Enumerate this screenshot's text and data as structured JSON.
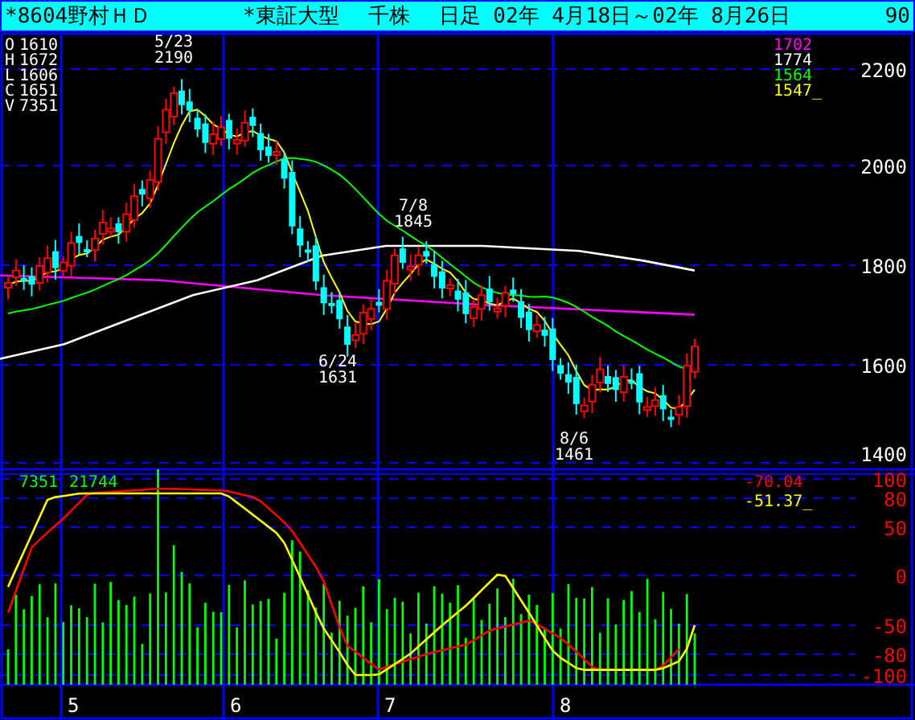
{
  "header": {
    "symbol": "*8604野村ＨＤ",
    "market": "*東証大型",
    "unit": "千株",
    "period": "日足 02年 4月18日～02年 8月26日",
    "count": "90"
  },
  "price_panel": {
    "ohlcv": [
      {
        "label": "O",
        "value": "1610"
      },
      {
        "label": "H",
        "value": "1672"
      },
      {
        "label": "L",
        "value": "1606"
      },
      {
        "label": "C",
        "value": "1651"
      },
      {
        "label": "V",
        "value": "7351"
      }
    ],
    "ma_readouts": [
      {
        "value": "1702",
        "color": "#ff00ff"
      },
      {
        "value": "1774",
        "color": "#ffffff"
      },
      {
        "value": "1564",
        "color": "#00ff00"
      },
      {
        "value": "1547_",
        "color": "#ffff00"
      }
    ],
    "y_axis": [
      "2200",
      "2000",
      "1800",
      "1600",
      "1400"
    ],
    "annotations": [
      {
        "date": "5/23",
        "price": "2190"
      },
      {
        "date": "6/24",
        "price": "1631"
      },
      {
        "date": "7/8",
        "price": "1845"
      },
      {
        "date": "8/6",
        "price": "1461"
      }
    ]
  },
  "oscillator_panel": {
    "readout": [
      "7351",
      "21744"
    ],
    "values": [
      {
        "value": "-70.04",
        "color": "#ff0000"
      },
      {
        "value": "-51.37_",
        "color": "#ffff00"
      }
    ],
    "y_axis": [
      "100",
      "80",
      "50",
      "0",
      "-50",
      "-80",
      "-100"
    ]
  },
  "x_axis": [
    "5",
    "6",
    "7",
    "8"
  ]
}
